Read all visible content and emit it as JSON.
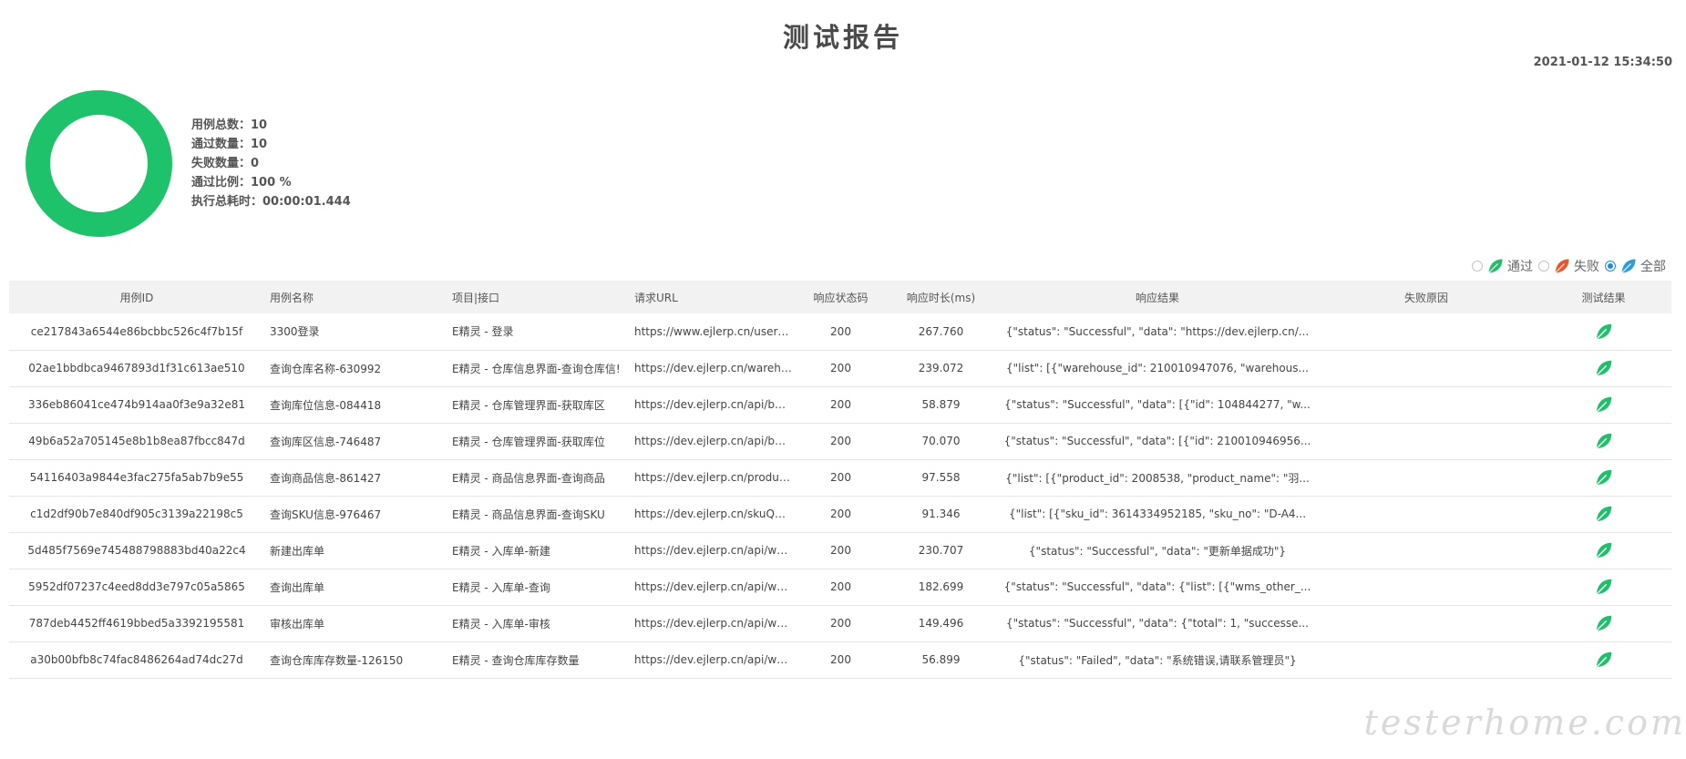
{
  "page": {
    "title": "测试报告",
    "timestamp": "2021-01-12 15:34:50"
  },
  "summary": {
    "total_label": "用例总数：",
    "total": "10",
    "pass_label": "通过数量：",
    "pass": "10",
    "fail_label": "失败数量：",
    "fail": "0",
    "rate_label": "通过比例：",
    "rate": "100 %",
    "duration_label": "执行总耗时：",
    "duration": "00:00:01.444",
    "pass_fraction": 1.0
  },
  "filters": {
    "pass_label": "通过",
    "fail_label": "失败",
    "all_label": "全部",
    "selected": "all"
  },
  "table": {
    "headers": [
      "用例ID",
      "用例名称",
      "项目|接口",
      "请求URL",
      "响应状态码",
      "响应时长(ms)",
      "响应结果",
      "失败原因",
      "测试结果"
    ],
    "rows": [
      [
        "ce217843a6544e86bcbbc526c4f7b15f",
        "3300登录",
        "E精灵 - 登录",
        "https://www.ejlerp.cn/user_l...",
        "200",
        "267.760",
        "{\"status\": \"Successful\", \"data\": \"https://dev.ejlerp.cn/...",
        "",
        "pass"
      ],
      [
        "02ae1bbdbca9467893d1f31c613ae510",
        "查询仓库名称-630992",
        "E精灵 - 仓库信息界面-查询仓库信!",
        "https://dev.ejlerp.cn/wareho...",
        "200",
        "239.072",
        "{\"list\": [{\"warehouse_id\": 210010947076, \"warehous...",
        "",
        "pass"
      ],
      [
        "336eb86041ce474b914aa0f3e9a32e81",
        "查询库位信息-084418",
        "E精灵 - 仓库管理界面-获取库区",
        "https://dev.ejlerp.cn/api/base...",
        "200",
        "58.879",
        "{\"status\": \"Successful\", \"data\": [{\"id\": 104844277, \"w...",
        "",
        "pass"
      ],
      [
        "49b6a52a705145e8b1b8ea87fbcc847d",
        "查询库区信息-746487",
        "E精灵 - 仓库管理界面-获取库位",
        "https://dev.ejlerp.cn/api/base...",
        "200",
        "70.070",
        "{\"status\": \"Successful\", \"data\": [{\"id\": 210010946956...",
        "",
        "pass"
      ],
      [
        "54116403a9844e3fac275fa5ab7b9e55",
        "查询商品信息-861427",
        "E精灵 - 商品信息界面-查询商品",
        "https://dev.ejlerp.cn/product...",
        "200",
        "97.558",
        "{\"list\": [{\"product_id\": 2008538, \"product_name\": \"羽...",
        "",
        "pass"
      ],
      [
        "c1d2df90b7e840df905c3139a22198c5",
        "查询SKU信息-976467",
        "E精灵 - 商品信息界面-查询SKU",
        "https://dev.ejlerp.cn/skuQuer...",
        "200",
        "91.346",
        "{\"list\": [{\"sku_id\": 3614334952185, \"sku_no\": \"D-A4...",
        "",
        "pass"
      ],
      [
        "5d485f7569e745488798883bd40a22c4",
        "新建出库单",
        "E精灵 - 入库单-新建",
        "https://dev.ejlerp.cn/api/wms...",
        "200",
        "230.707",
        "{\"status\": \"Successful\", \"data\": \"更新单据成功\"}",
        "",
        "pass"
      ],
      [
        "5952df07237c4eed8dd3e797c05a5865",
        "查询出库单",
        "E精灵 - 入库单-查询",
        "https://dev.ejlerp.cn/api/wms...",
        "200",
        "182.699",
        "{\"status\": \"Successful\", \"data\": {\"list\": [{\"wms_other_...",
        "",
        "pass"
      ],
      [
        "787deb4452ff4619bbed5a3392195581",
        "审核出库单",
        "E精灵 - 入库单-审核",
        "https://dev.ejlerp.cn/api/wms...",
        "200",
        "149.496",
        "{\"status\": \"Successful\", \"data\": {\"total\": 1, \"successe...",
        "",
        "pass"
      ],
      [
        "a30b00bfb8c74fac8486264ad74dc27d",
        "查询仓库库存数量-126150",
        "E精灵 - 查询仓库库存数量",
        "https://dev.ejlerp.cn/api/wms...",
        "200",
        "56.899",
        "{\"status\": \"Failed\", \"data\": \"系统错误,请联系管理员\"}",
        "",
        "pass"
      ]
    ]
  },
  "watermark": "testerhome.com",
  "colors": {
    "pass": "#20bf6b",
    "fail": "#e8572e",
    "all": "#2a9fd6",
    "donut": "#1ec26a"
  },
  "icons": {
    "pass": "leaf-green-icon",
    "fail": "leaf-red-icon",
    "all": "leaf-blue-icon"
  }
}
